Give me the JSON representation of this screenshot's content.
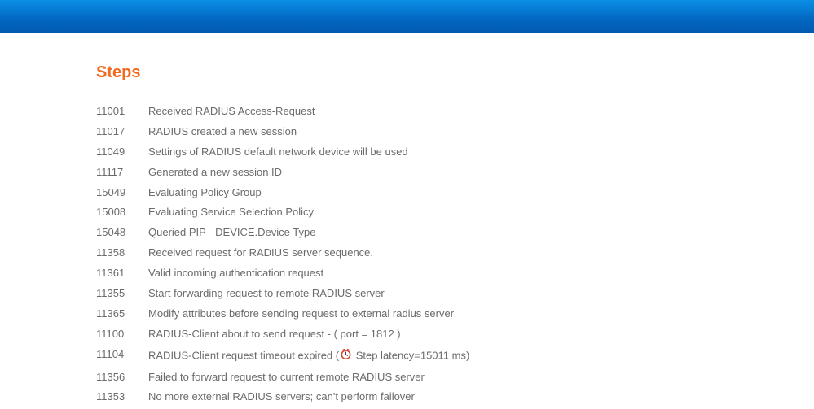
{
  "title": "Steps",
  "steps": [
    {
      "code": "11001",
      "desc": "Received RADIUS Access-Request"
    },
    {
      "code": "11017",
      "desc": "RADIUS created a new session"
    },
    {
      "code": "11049",
      "desc": "Settings of RADIUS default network device will be used"
    },
    {
      "code": "11117",
      "desc": "Generated a new session ID"
    },
    {
      "code": "15049",
      "desc": "Evaluating Policy Group"
    },
    {
      "code": "15008",
      "desc": "Evaluating Service Selection Policy"
    },
    {
      "code": "15048",
      "desc": "Queried PIP - DEVICE.Device Type"
    },
    {
      "code": "11358",
      "desc": "Received request for RADIUS server sequence."
    },
    {
      "code": "11361",
      "desc": "Valid incoming authentication request"
    },
    {
      "code": "11355",
      "desc": "Start forwarding request to remote RADIUS server"
    },
    {
      "code": "11365",
      "desc": "Modify attributes before sending request to external radius server"
    },
    {
      "code": "11100",
      "desc": "RADIUS-Client about to send request - ( port = 1812 )"
    },
    {
      "code": "11104",
      "desc_pre": "RADIUS-Client request timeout expired (",
      "has_icon": true,
      "desc_post": " Step latency=15011 ms)"
    },
    {
      "code": "11356",
      "desc": "Failed to forward request to current remote RADIUS server"
    },
    {
      "code": "11353",
      "desc": "No more external RADIUS servers; can't perform failover"
    }
  ]
}
